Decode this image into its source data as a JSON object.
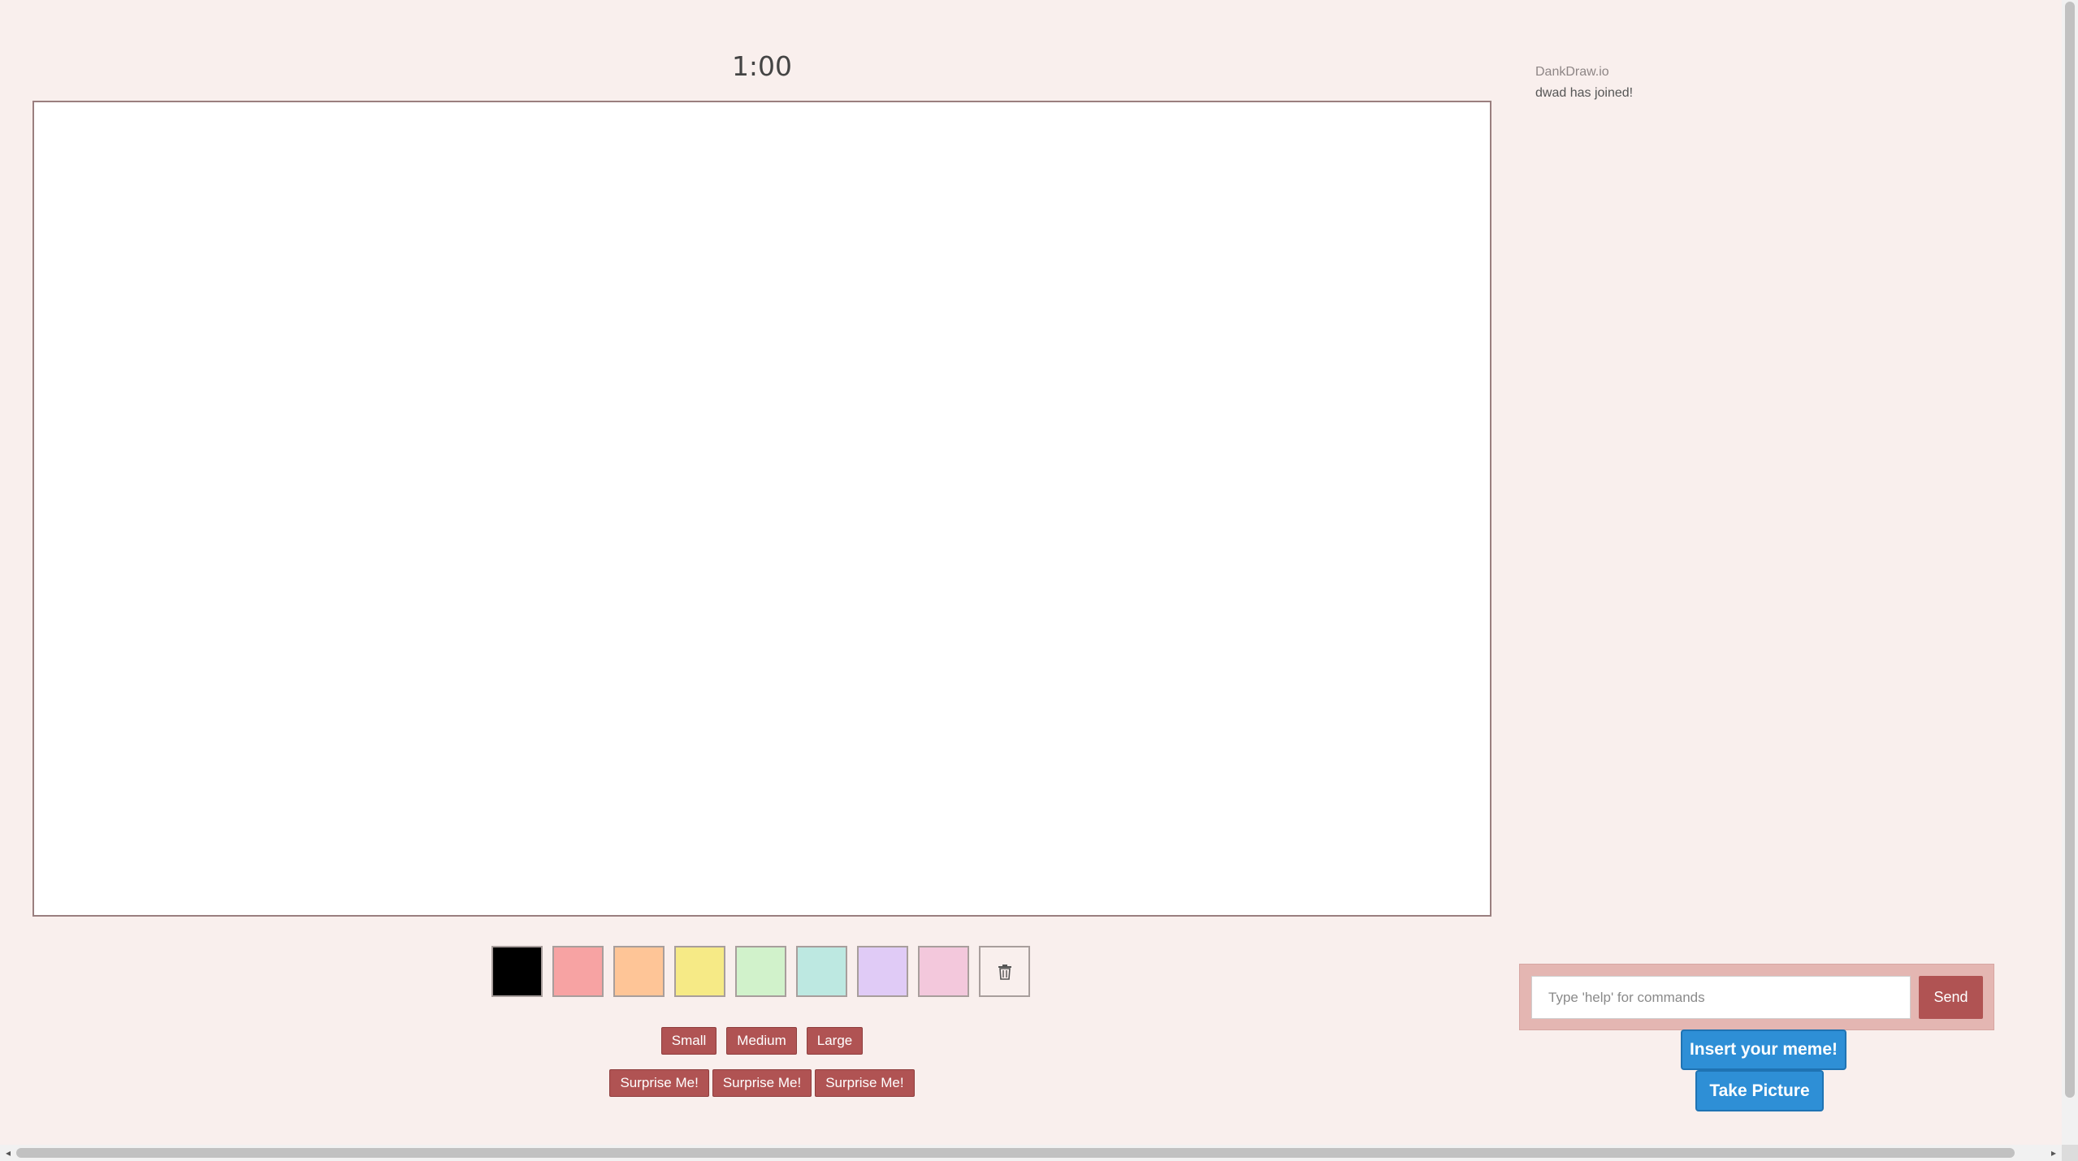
{
  "timer": {
    "text": "1:00"
  },
  "palette": {
    "colors": [
      "#000000",
      "#f7a3a3",
      "#fec597",
      "#f6ea86",
      "#d1f2cb",
      "#bde8e1",
      "#e0cbf6",
      "#f3c8dc"
    ],
    "clear_icon": "trash-icon"
  },
  "brush_sizes": [
    "Small",
    "Medium",
    "Large"
  ],
  "surprise_buttons": [
    "Surprise Me!",
    "Surprise Me!",
    "Surprise Me!"
  ],
  "chat": {
    "header": "DankDraw.io",
    "messages": [
      "dwad has joined!"
    ],
    "input_placeholder": "Type 'help' for commands",
    "send_label": "Send"
  },
  "actions": {
    "insert_meme_label": "Insert your meme!",
    "take_picture_label": "Take Picture"
  }
}
